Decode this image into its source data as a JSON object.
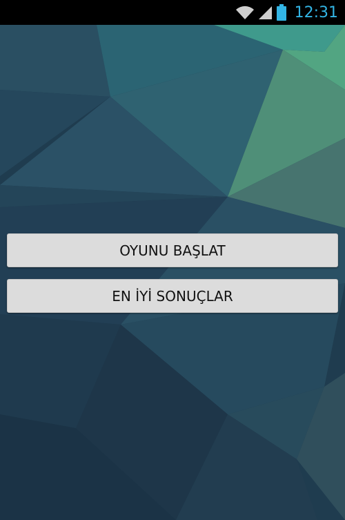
{
  "status_bar": {
    "time": "12:31",
    "icons": [
      "wifi-icon",
      "signal-icon",
      "battery-icon"
    ],
    "accent_color": "#33b5e5"
  },
  "menu": {
    "start_game_label": "OYUNU BAŞLAT",
    "high_scores_label": "EN İYİ SONUÇLAR"
  }
}
